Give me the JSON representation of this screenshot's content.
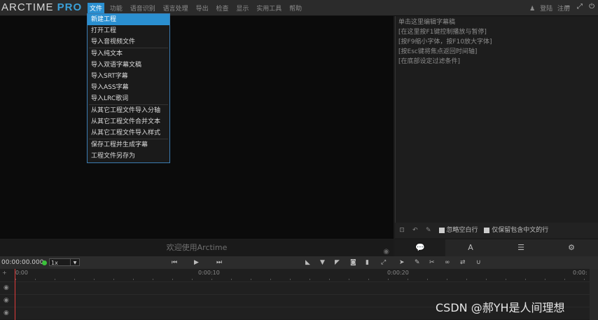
{
  "app": {
    "logo_main": "ARCTIME",
    "logo_pro": "PRO"
  },
  "menubar": [
    "文件",
    "功能",
    "语音识别",
    "语言处理",
    "导出",
    "检查",
    "显示",
    "实用工具",
    "帮助"
  ],
  "auth": {
    "login": "登陆",
    "register": "注册"
  },
  "window_controls": "− ⤢ ⏻",
  "file_menu": [
    "新建工程",
    "打开工程",
    "导入音视频文件",
    "导入纯文本",
    "导入双语字幕文稿",
    "导入SRT字幕",
    "导入ASS字幕",
    "导入LRC歌词",
    "从其它工程文件导入分轴",
    "从其它工程文件合并文本",
    "从其它工程文件导入样式",
    "保存工程并生成字幕",
    "工程文件另存为"
  ],
  "editor_hint": [
    "单击这里编辑字幕稿",
    "[在这里按F1键控制播放与暂停]",
    "[按F9缩小字体，按F10放大字体]",
    "[按Esc键将焦点返回时间轴]",
    "[在底部设定过滤条件]"
  ],
  "options": {
    "ignore_empty": "忽略空白行",
    "keep_chinese": "仅保留包含中文的行"
  },
  "welcome": "欢迎使用Arctime",
  "panel_tabs": [
    "💬",
    "A",
    "☰",
    "⚙"
  ],
  "timeline": {
    "timecode": "00:00:00.000",
    "rate": "1x",
    "ticks": [
      "0:00",
      "0:00:10",
      "0:00:20",
      "0:00:"
    ]
  },
  "watermark": "CSDN @郝YH是人间理想"
}
